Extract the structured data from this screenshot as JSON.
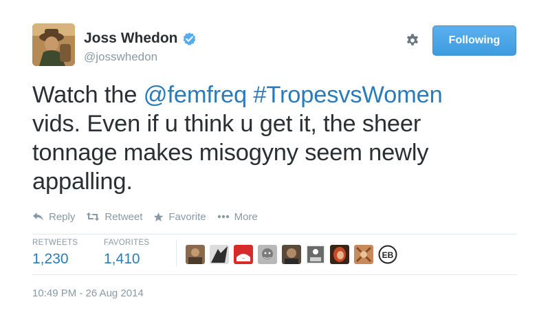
{
  "author": {
    "name": "Joss Whedon",
    "handle": "@josswhedon",
    "verified": true,
    "avatar_icon": "user-avatar"
  },
  "follow_button": {
    "label": "Following",
    "color": "#4aa5e8"
  },
  "settings_icon": "gear-icon",
  "tweet": {
    "line1_prefix": "Watch the ",
    "mention": "@femfreq",
    "space": " ",
    "hashtag": "#TropesvsWomen",
    "line2": "vids. Even if u think u get it, the sheer",
    "line3": "tonnage makes misogyny seem newly",
    "line4": "appalling."
  },
  "actions": [
    {
      "label": "Reply",
      "icon": "reply-icon"
    },
    {
      "label": "Retweet",
      "icon": "retweet-icon"
    },
    {
      "label": "Favorite",
      "icon": "star-icon"
    },
    {
      "label": "More",
      "icon": "more-icon"
    }
  ],
  "stats": {
    "retweets_label": "RETWEETS",
    "retweets_value": "1,230",
    "favorites_label": "FAVORITES",
    "favorites_value": "1,410"
  },
  "favoriters": [
    {
      "name": "favoriter-avatar-1",
      "color": "#8a6a4a"
    },
    {
      "name": "favoriter-avatar-2",
      "color": "#3a3a3a"
    },
    {
      "name": "favoriter-avatar-3",
      "color": "#d62b2b"
    },
    {
      "name": "favoriter-avatar-4",
      "color": "#9a9a9a"
    },
    {
      "name": "favoriter-avatar-5",
      "color": "#5b4a3a"
    },
    {
      "name": "favoriter-avatar-6",
      "color": "#6a6a6a"
    },
    {
      "name": "favoriter-avatar-7",
      "color": "#c44a2a"
    },
    {
      "name": "favoriter-avatar-8",
      "color": "#c98a5a"
    },
    {
      "name": "favoriter-avatar-9",
      "color": "#ffffff"
    }
  ],
  "eb_logo_text": "EB",
  "timestamp": "10:49 PM - 26 Aug 2014",
  "colors": {
    "link": "#2b7bb9",
    "muted": "#8899a6",
    "text": "#292f33",
    "divider": "#e1e8ed"
  }
}
